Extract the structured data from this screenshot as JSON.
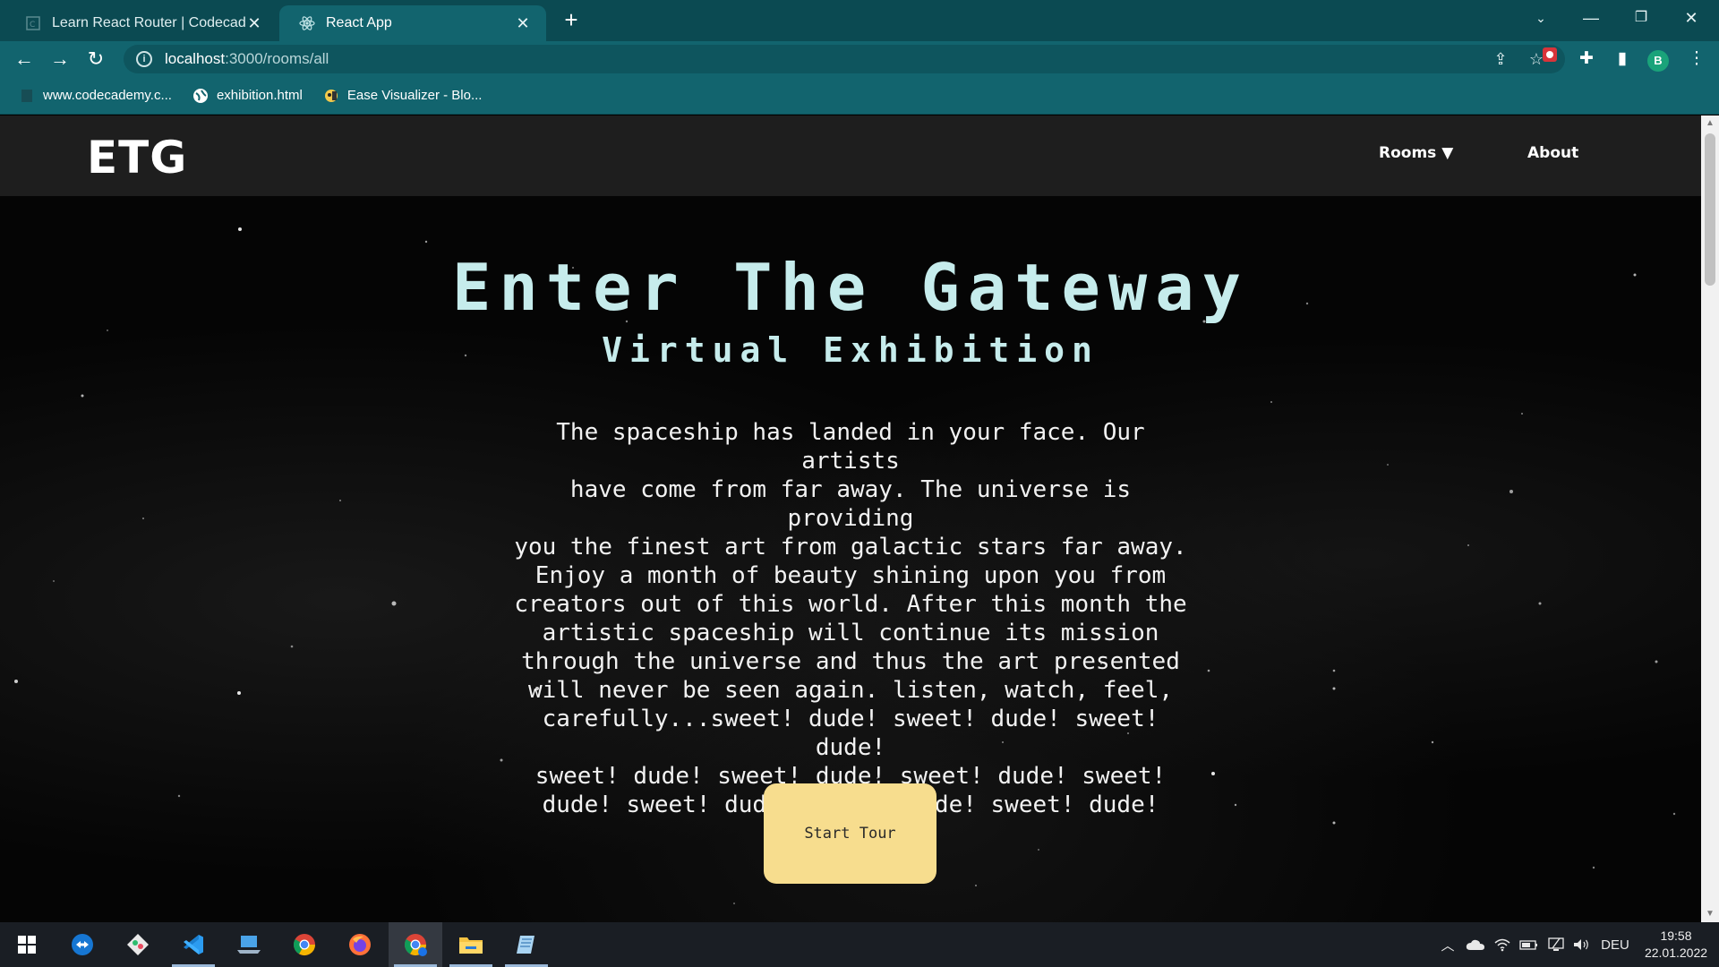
{
  "browser": {
    "tabs": [
      {
        "title": "Learn React Router | Codecadem",
        "icon": "codecademy-icon",
        "active": false
      },
      {
        "title": "React App",
        "icon": "react-icon",
        "active": true
      }
    ],
    "url": {
      "host": "localhost",
      "path": ":3000/rooms/all"
    },
    "bookmarks": [
      {
        "label": "www.codecademy.c...",
        "icon": "page-icon"
      },
      {
        "label": "exhibition.html",
        "icon": "globe-icon"
      },
      {
        "label": "Ease Visualizer - Blo...",
        "icon": "visualizer-icon"
      }
    ],
    "profile_initial": "B"
  },
  "site": {
    "logo": "ETG",
    "nav": {
      "rooms": "Rooms ▼",
      "about": "About"
    },
    "hero": {
      "title": "Enter The Gateway",
      "subtitle": "Virtual Exhibition",
      "lines": [
        "The spaceship has landed in your face. Our artists",
        "have come from far away. The universe is providing",
        "you the finest art from galactic stars far away.",
        "Enjoy a month of beauty shining upon you from",
        "creators out of this world. After this month the",
        "artistic spaceship will continue its mission",
        "through the universe and thus the art presented",
        "will never be seen again. listen, watch, feel,",
        "carefully...sweet! dude! sweet! dude! sweet! dude!",
        "sweet! dude! sweet! dude! sweet! dude! sweet!",
        "dude! sweet! dude! sweet! dude! sweet! dude!"
      ],
      "button": "Start Tour"
    },
    "colors": {
      "title": "#c6ecec",
      "button": "#f7dd8e",
      "nav_bg": "#1e1e1e"
    }
  },
  "taskbar": {
    "apps": [
      "windows-start-icon",
      "teamviewer-icon",
      "gitkraken-icon",
      "vscode-icon",
      "laptop-icon",
      "chrome-icon",
      "firefox-icon",
      "chrome-dev-icon",
      "file-explorer-icon",
      "notepad-icon"
    ],
    "language": "DEU",
    "time": "19:58",
    "date": "22.01.2022"
  }
}
